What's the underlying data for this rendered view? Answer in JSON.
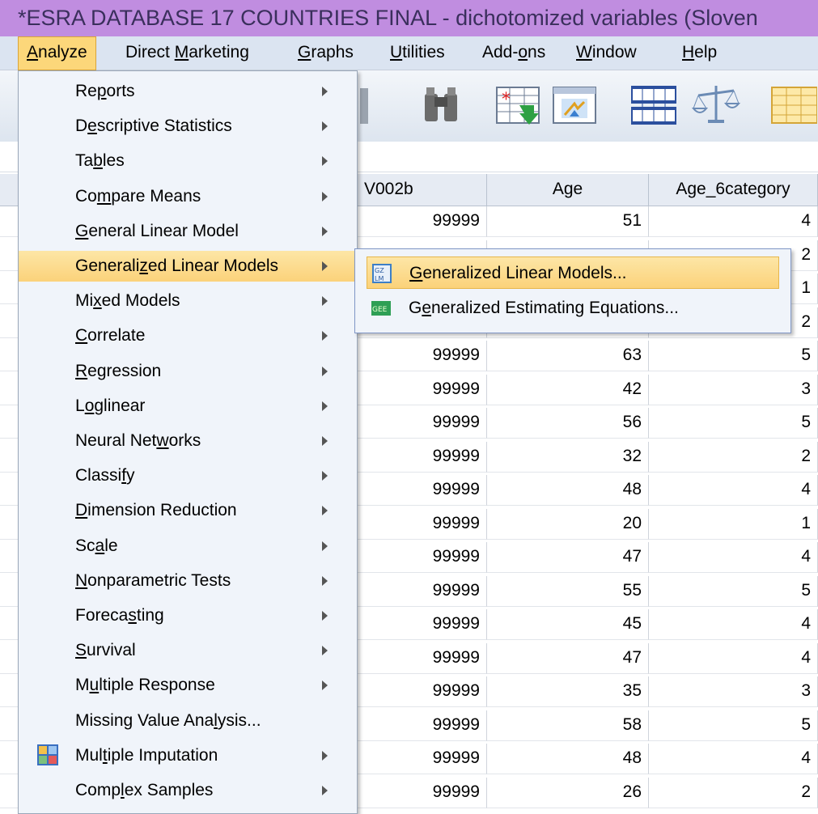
{
  "window": {
    "title": "*ESRA DATABASE 17 COUNTRIES FINAL - dichotomized variables (Sloven"
  },
  "menubar": {
    "items": [
      {
        "pre": "",
        "u": "A",
        "post": "nalyze"
      },
      {
        "pre": "Direct ",
        "u": "M",
        "post": "arketing"
      },
      {
        "pre": "",
        "u": "G",
        "post": "raphs"
      },
      {
        "pre": "",
        "u": "U",
        "post": "tilities"
      },
      {
        "pre": "Add-",
        "u": "o",
        "post": "ns"
      },
      {
        "pre": "",
        "u": "W",
        "post": "indow"
      },
      {
        "pre": "",
        "u": "H",
        "post": "elp"
      }
    ]
  },
  "toolbar": {
    "icons": [
      "find-binoculars-icon",
      "insert-cases-icon",
      "insert-variable-icon",
      "split-file-icon",
      "weight-cases-icon",
      "select-cases-icon"
    ]
  },
  "grid": {
    "columns": [
      "V002b",
      "Age",
      "Age_6category"
    ],
    "rows": [
      [
        "99999",
        "51",
        "4"
      ],
      [
        "",
        "",
        "2"
      ],
      [
        "",
        "",
        "1"
      ],
      [
        "",
        "",
        "2"
      ],
      [
        "99999",
        "63",
        "5"
      ],
      [
        "99999",
        "42",
        "3"
      ],
      [
        "99999",
        "56",
        "5"
      ],
      [
        "99999",
        "32",
        "2"
      ],
      [
        "99999",
        "48",
        "4"
      ],
      [
        "99999",
        "20",
        "1"
      ],
      [
        "99999",
        "47",
        "4"
      ],
      [
        "99999",
        "55",
        "5"
      ],
      [
        "99999",
        "45",
        "4"
      ],
      [
        "99999",
        "47",
        "4"
      ],
      [
        "99999",
        "35",
        "3"
      ],
      [
        "99999",
        "58",
        "5"
      ],
      [
        "99999",
        "48",
        "4"
      ],
      [
        "99999",
        "26",
        "2"
      ]
    ]
  },
  "analyze_menu": {
    "items": [
      {
        "pre": "Re",
        "u": "p",
        "post": "orts",
        "submenu": true
      },
      {
        "pre": "D",
        "u": "e",
        "post": "scriptive Statistics",
        "submenu": true
      },
      {
        "pre": "Ta",
        "u": "b",
        "post": "les",
        "submenu": true
      },
      {
        "pre": "Co",
        "u": "m",
        "post": "pare Means",
        "submenu": true
      },
      {
        "pre": "",
        "u": "G",
        "post": "eneral Linear Model",
        "submenu": true
      },
      {
        "pre": "Generali",
        "u": "z",
        "post": "ed Linear Models",
        "submenu": true,
        "highlighted": true
      },
      {
        "pre": "Mi",
        "u": "x",
        "post": "ed Models",
        "submenu": true
      },
      {
        "pre": "",
        "u": "C",
        "post": "orrelate",
        "submenu": true
      },
      {
        "pre": "",
        "u": "R",
        "post": "egression",
        "submenu": true
      },
      {
        "pre": "L",
        "u": "o",
        "post": "glinear",
        "submenu": true
      },
      {
        "pre": "Neural Net",
        "u": "w",
        "post": "orks",
        "submenu": true
      },
      {
        "pre": "Classi",
        "u": "f",
        "post": "y",
        "submenu": true
      },
      {
        "pre": "",
        "u": "D",
        "post": "imension Reduction",
        "submenu": true
      },
      {
        "pre": "Sc",
        "u": "a",
        "post": "le",
        "submenu": true
      },
      {
        "pre": "",
        "u": "N",
        "post": "onparametric Tests",
        "submenu": true
      },
      {
        "pre": "Foreca",
        "u": "s",
        "post": "ting",
        "submenu": true
      },
      {
        "pre": "",
        "u": "S",
        "post": "urvival",
        "submenu": true
      },
      {
        "pre": "M",
        "u": "u",
        "post": "ltiple Response",
        "submenu": true
      },
      {
        "pre": "Missing Value Ana",
        "u": "l",
        "post": "ysis...",
        "submenu": false,
        "icon": "missing-value-icon"
      },
      {
        "pre": "Mul",
        "u": "t",
        "post": "iple Imputation",
        "submenu": true
      },
      {
        "pre": "Comp",
        "u": "l",
        "post": "ex Samples",
        "submenu": true
      }
    ]
  },
  "submenu": {
    "items": [
      {
        "pre": "",
        "u": "G",
        "post": "eneralized Linear Models...",
        "icon": "glm-icon",
        "highlighted": true
      },
      {
        "pre": "G",
        "u": "e",
        "post": "neralized Estimating Equations...",
        "icon": "gee-icon"
      }
    ]
  }
}
